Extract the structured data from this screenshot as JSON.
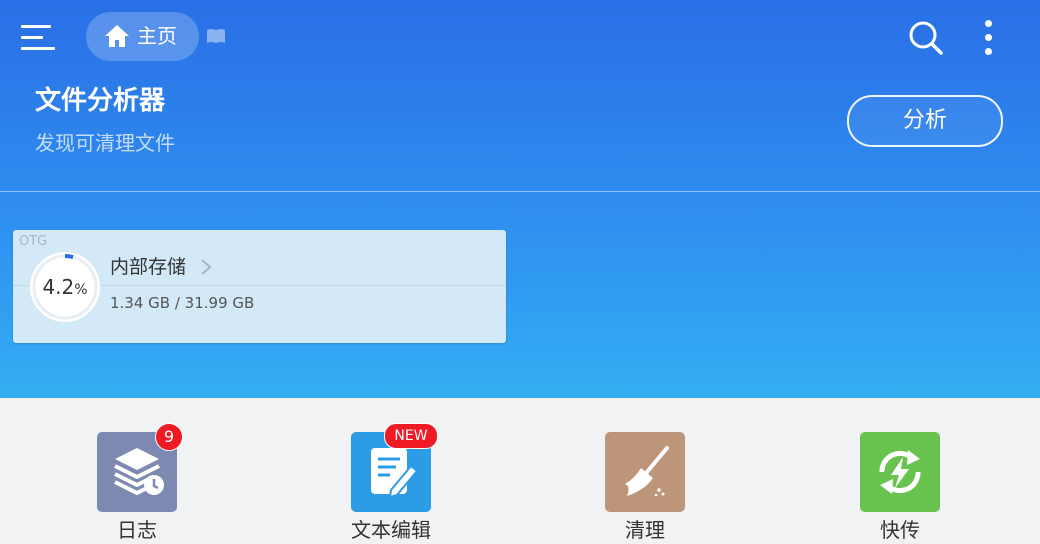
{
  "toolbar": {
    "home_label": "主页"
  },
  "banner": {
    "title": "文件分析器",
    "subtitle": "发现可清理文件",
    "analyze_label": "分析"
  },
  "storage": {
    "tag": "OTG",
    "percent": "4.2",
    "percent_unit": "%",
    "name": "内部存储",
    "size": "1.34 GB / 31.99 GB",
    "used_fraction": 0.042
  },
  "tools": [
    {
      "label": "日志",
      "badge": "9",
      "icon": "log-stack-icon",
      "color": "#7e89b1"
    },
    {
      "label": "文本编辑",
      "badge": "NEW",
      "icon": "text-edit-icon",
      "color": "#2c9ce7"
    },
    {
      "label": "清理",
      "icon": "broom-icon",
      "color": "#bd9579"
    },
    {
      "label": "快传",
      "icon": "transfer-bolt-icon",
      "color": "#68c24e"
    }
  ],
  "colors": {
    "header_top": "#2a6fe6",
    "header_bottom": "#33aef2",
    "badge_red": "#f01a24",
    "ring_accent": "#2a6fe6"
  }
}
